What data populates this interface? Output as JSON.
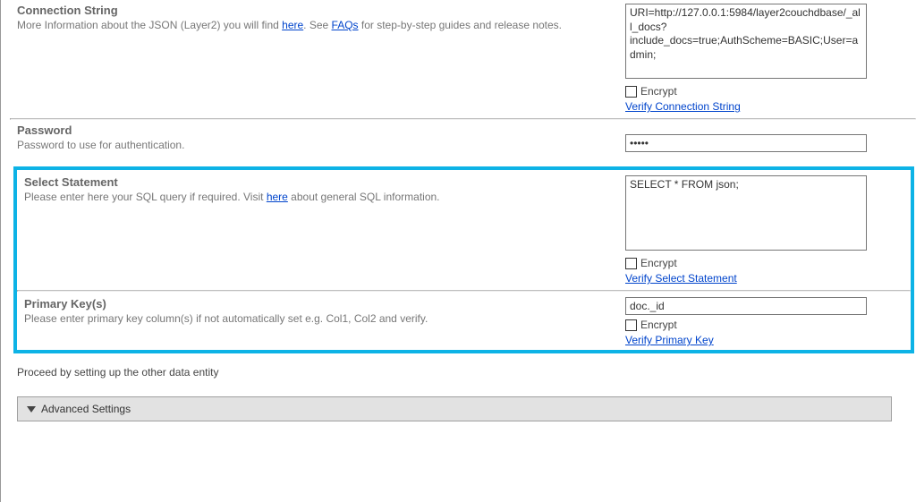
{
  "conn": {
    "heading": "Connection String",
    "desc_pre": "More Information about the JSON (Layer2) you will find ",
    "here": "here",
    "desc_mid": ". See ",
    "faqs": "FAQs",
    "desc_post": " for step-by-step guides and release notes.",
    "value": "URI=http://127.0.0.1:5984/layer2couchdbase/_all_docs?include_docs=true;AuthScheme=BASIC;User=admin;",
    "encrypt": "Encrypt",
    "verify": "Verify Connection String"
  },
  "pwd": {
    "heading": "Password",
    "desc": "Password to use for authentication.",
    "value": "•••••"
  },
  "sel": {
    "heading": "Select Statement",
    "desc_pre": "Please enter here your SQL query if required. Visit ",
    "here": "here",
    "desc_post": " about general SQL information.",
    "value": "SELECT * FROM json;",
    "encrypt": "Encrypt",
    "verify": "Verify Select Statement"
  },
  "pk": {
    "heading": "Primary Key(s)",
    "desc": "Please enter primary key column(s) if not automatically set e.g. Col1, Col2 and verify.",
    "value": "doc._id",
    "encrypt": "Encrypt",
    "verify": "Verify Primary Key"
  },
  "proceed": "Proceed by setting up the other data entity",
  "advanced": "Advanced Settings"
}
